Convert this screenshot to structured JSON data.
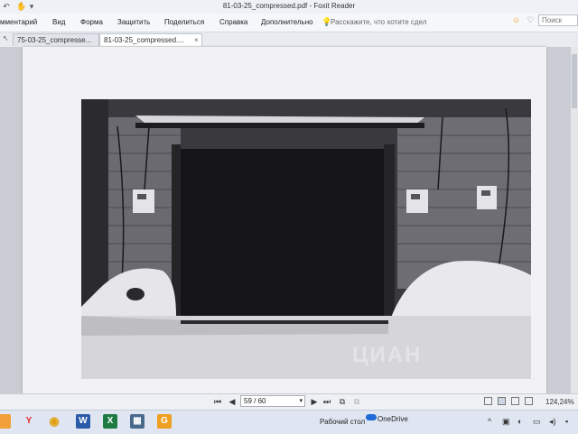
{
  "window": {
    "title": "81-03-25_compressed.pdf - Foxit Reader"
  },
  "menu": {
    "items": [
      "мментарий",
      "Вид",
      "Форма",
      "Защитить",
      "Поделиться",
      "Справка",
      "Дополнительно"
    ],
    "tell_me": "Расскажите, что хотите сдел",
    "search_placeholder": "Поиск"
  },
  "tabs": [
    {
      "label": "75-03-25_compresse..."
    },
    {
      "label": "81-03-25_compressed...."
    }
  ],
  "navigation": {
    "page_value": "59 / 60",
    "zoom": "124,24%"
  },
  "photo": {
    "watermark": "ЦИАН"
  },
  "taskbar": {
    "desktop_label": "Рабочий стол",
    "onedrive_label": "OneDrive"
  },
  "colors": {
    "accent": "#f0a020",
    "onedrive": "#1e6ad6",
    "excel": "#1d7a43",
    "word": "#2b5aa8"
  }
}
